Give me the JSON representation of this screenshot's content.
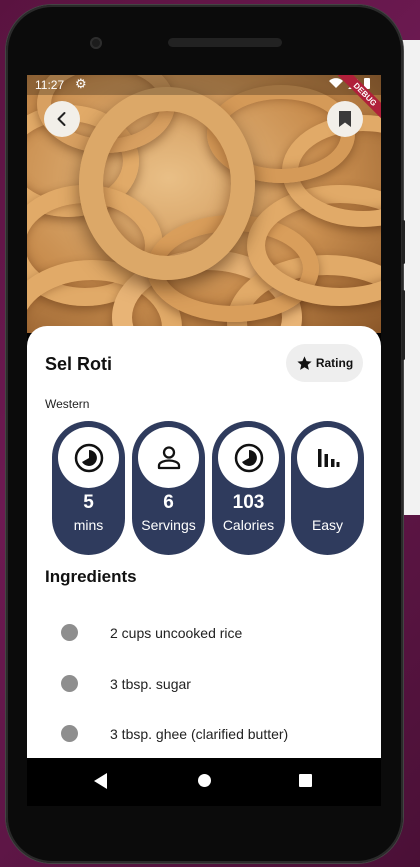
{
  "status_bar": {
    "time": "11:27",
    "settings_icon": "gear-icon",
    "indicators": "wifi-signal-battery-icons",
    "debug_banner": "DEBUG"
  },
  "header": {
    "back_icon": "chevron-left-icon",
    "bookmark_icon": "bookmark-icon"
  },
  "recipe": {
    "title": "Sel Roti",
    "category": "Western",
    "rating_label": "Rating",
    "rating_icon": "star-icon"
  },
  "stats": [
    {
      "icon": "timer-icon",
      "value": "5",
      "label": "mins"
    },
    {
      "icon": "person-icon",
      "value": "6",
      "label": "Servings"
    },
    {
      "icon": "timer-icon",
      "value": "103",
      "label": "Calories"
    },
    {
      "icon": "bar-chart-icon",
      "value": "",
      "label": "Easy"
    }
  ],
  "ingredients": {
    "title": "Ingredients",
    "items": [
      "2 cups uncooked rice",
      "3 tbsp. sugar",
      "3 tbsp. ghee (clarified butter)"
    ]
  },
  "colors": {
    "stat_background": "#2f3b5d",
    "bullet": "#8e8e8e",
    "sheet": "#ffffff"
  }
}
